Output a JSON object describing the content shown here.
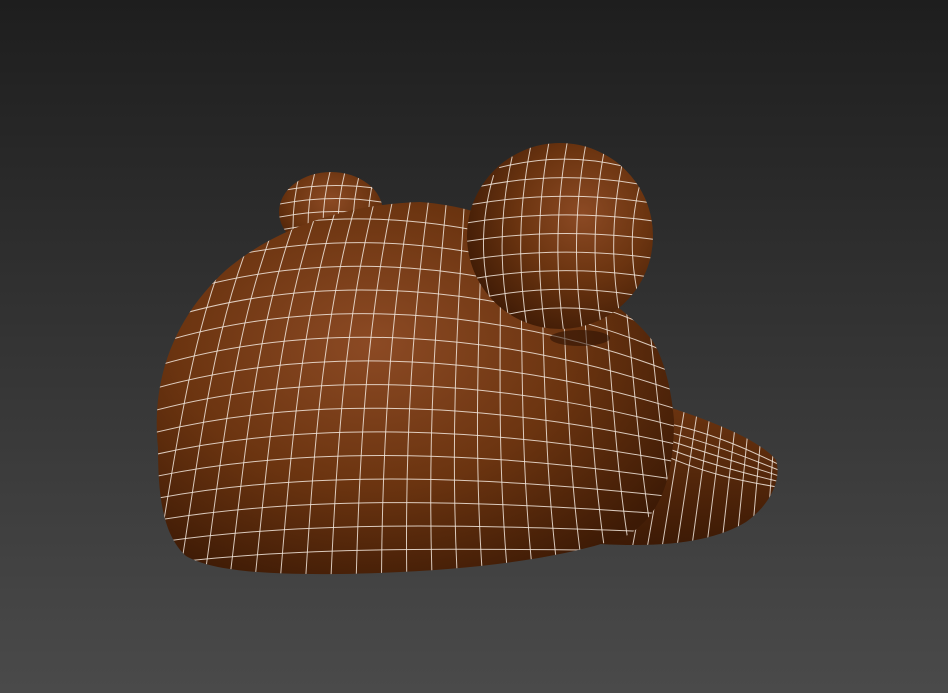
{
  "viewport": {
    "background_top": "#1e1e1e",
    "background_bottom": "#4a4a4a"
  },
  "model": {
    "name": "bear-ear-cap",
    "material_base": "#6b3410",
    "material_light": "#8c4a24",
    "material_dark": "#3d1a05",
    "wireframe_color": "#f2e6dc",
    "parts": [
      "dome",
      "left-ear",
      "right-ear",
      "brim"
    ]
  }
}
